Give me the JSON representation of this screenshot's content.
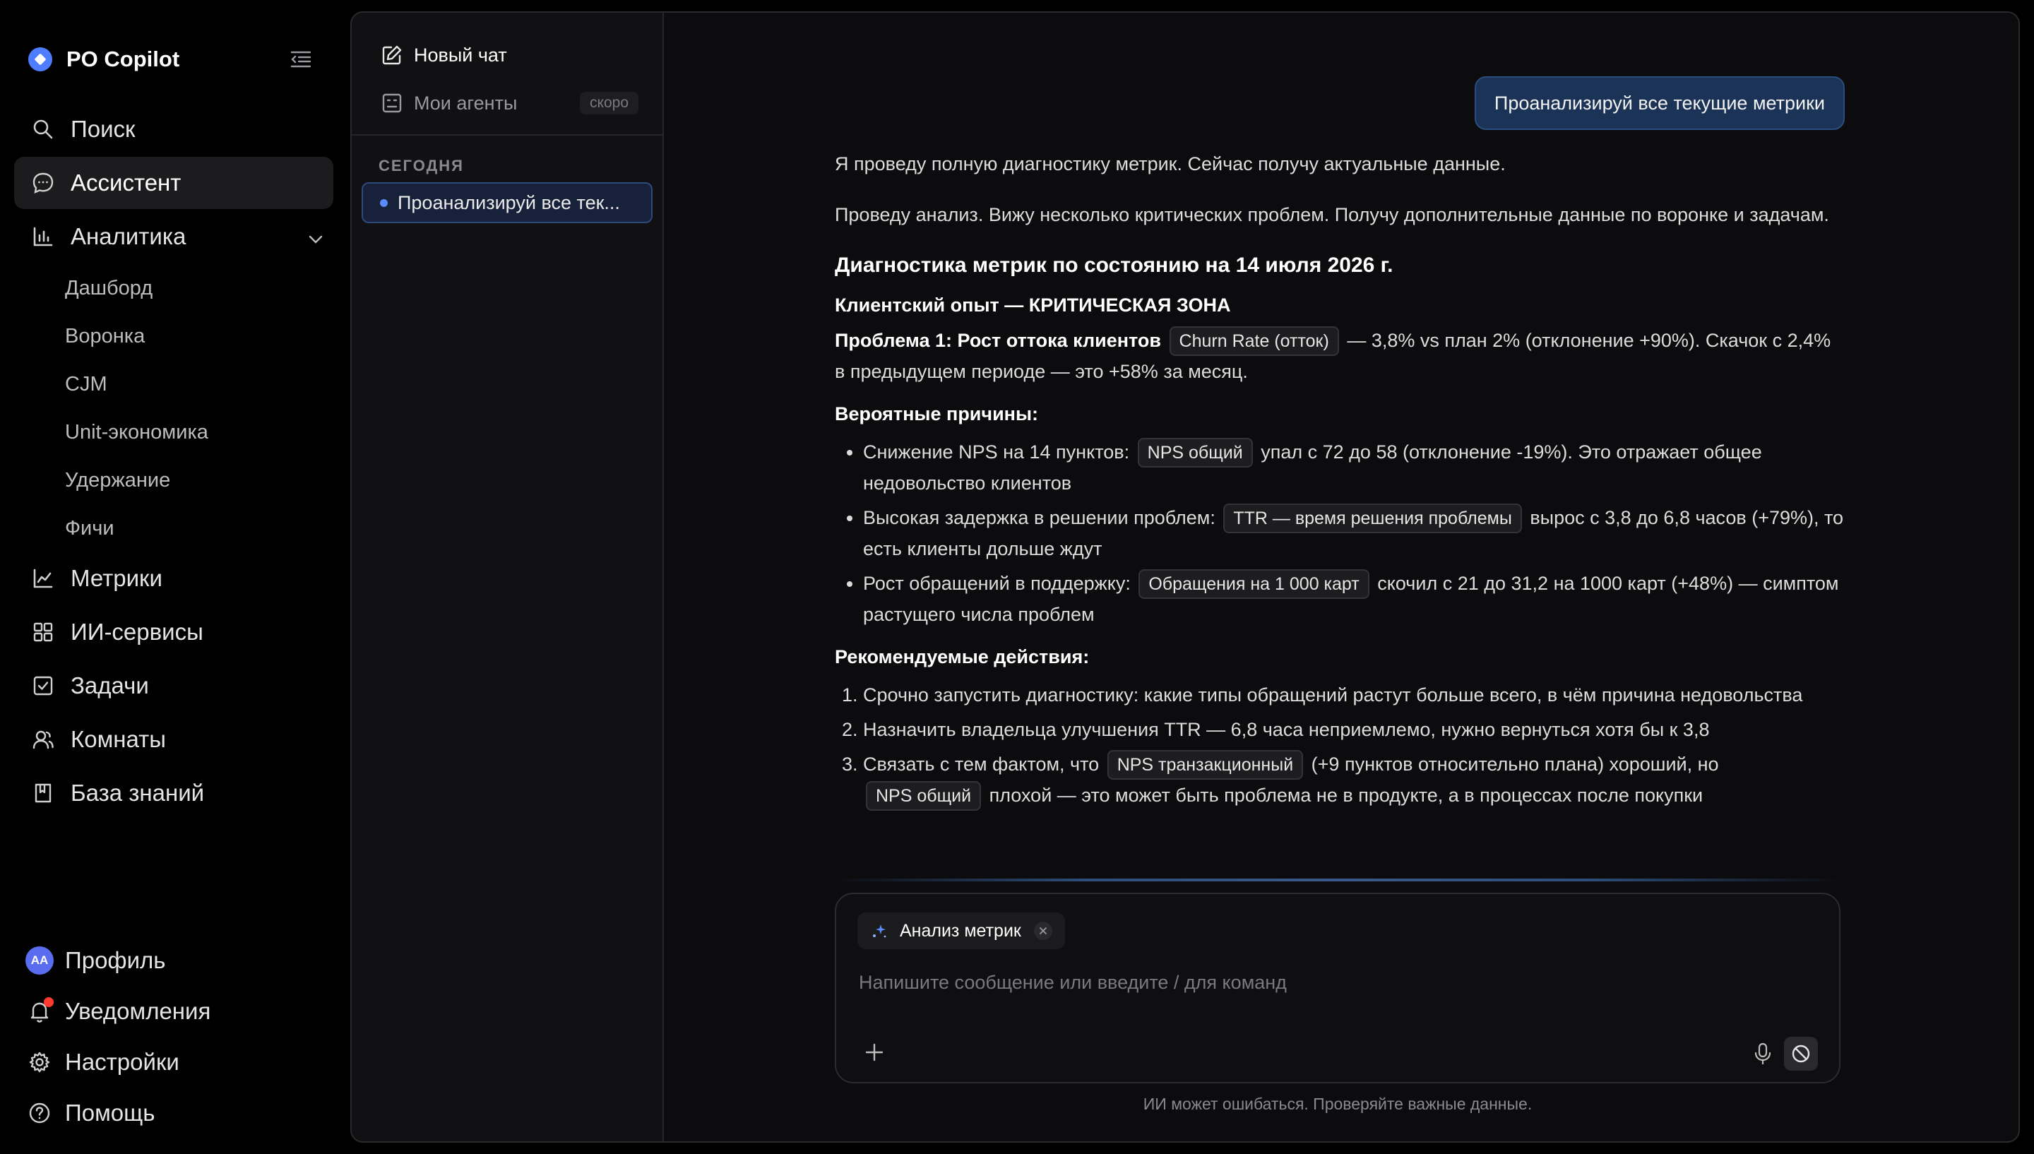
{
  "app": {
    "title": "PO Copilot"
  },
  "sidebar": {
    "items": [
      {
        "label": "Поиск",
        "icon": "search-icon"
      },
      {
        "label": "Ассистент",
        "icon": "chat-bubble-icon",
        "active": true
      },
      {
        "label": "Аналитика",
        "icon": "bar-chart-icon",
        "expanded": true
      }
    ],
    "analytics_sub": [
      "Дашборд",
      "Воронка",
      "CJM",
      "Unit-экономика",
      "Удержание",
      "Фичи"
    ],
    "items_after": [
      {
        "label": "Метрики",
        "icon": "line-chart-icon"
      },
      {
        "label": "ИИ-сервисы",
        "icon": "grid-icon"
      },
      {
        "label": "Задачи",
        "icon": "checkbox-icon"
      },
      {
        "label": "Комнаты",
        "icon": "users-icon"
      },
      {
        "label": "База знаний",
        "icon": "book-icon"
      }
    ],
    "bottom": {
      "profile": "Профиль",
      "avatar_initials": "AA",
      "notifications": "Уведомления",
      "settings": "Настройки",
      "help": "Помощь"
    }
  },
  "chats": {
    "new_chat": "Новый чат",
    "my_agents": "Мои агенты",
    "soon_badge": "скоро",
    "section": "СЕГОДНЯ",
    "items": [
      {
        "title": "Проанализируй все тек...",
        "active": true
      }
    ]
  },
  "conversation": {
    "user_message": "Проанализируй все текущие метрики",
    "assistant": {
      "p1": "Я проведу полную диагностику метрик. Сейчас получу актуальные данные.",
      "p2": "Проведу анализ. Вижу несколько критических проблем. Получу дополнительные данные по воронке и задачам.",
      "heading": "Диагностика метрик по состоянию на 14 июля 2026 г.",
      "zone": "Клиентский опыт — КРИТИЧЕСКАЯ ЗОНА",
      "problem_title": "Проблема 1: Рост оттока клиентов",
      "problem_tag": "Churn Rate (отток)",
      "problem_text": " — 3,8% vs план 2% (отклонение +90%). Скачок с 2,4% в предыдущем периоде — это +58% за месяц.",
      "causes_title": "Вероятные причины:",
      "causes": [
        {
          "pre": "Снижение NPS на 14 пунктов:",
          "tag": "NPS общий",
          "post": "упал с 72 до 58 (отклонение -19%). Это отражает общее недовольство клиентов"
        },
        {
          "pre": "Высокая задержка в решении проблем:",
          "tag": "TTR — время решения проблемы",
          "post": "вырос с 3,8 до 6,8 часов (+79%), то есть клиенты дольше ждут"
        },
        {
          "pre": "Рост обращений в поддержку:",
          "tag": "Обращения на 1 000 карт",
          "post": "скочил с 21 до 31,2 на 1000 карт (+48%) — симптом растущего числа проблем"
        }
      ],
      "actions_title": "Рекомендуемые действия:",
      "actions": {
        "a1": "Срочно запустить диагностику: какие типы обращений растут больше всего, в чём причина недовольства",
        "a2": "Назначить владельца улучшения TTR — 6,8 часа неприемлемо, нужно вернуться хотя бы к 3,8",
        "a3_pre": "Связать с тем фактом, что",
        "a3_tag1": "NPS транзакционный",
        "a3_mid": "(+9 пунктов относительно плана) хороший, но",
        "a3_tag2": "NPS общий",
        "a3_post": "плохой — это может быть проблема не в продукте, а в процессах после покупки"
      }
    }
  },
  "composer": {
    "chip_label": "Анализ метрик",
    "placeholder": "Напишите сообщение или введите / для команд",
    "disclaimer": "ИИ может ошибаться. Проверяйте важные данные."
  },
  "colors": {
    "accent": "#4f7dff",
    "user_bubble": "#1b3356",
    "active_nav": "#1c1c1e",
    "notification_dot": "#ff3b30"
  }
}
